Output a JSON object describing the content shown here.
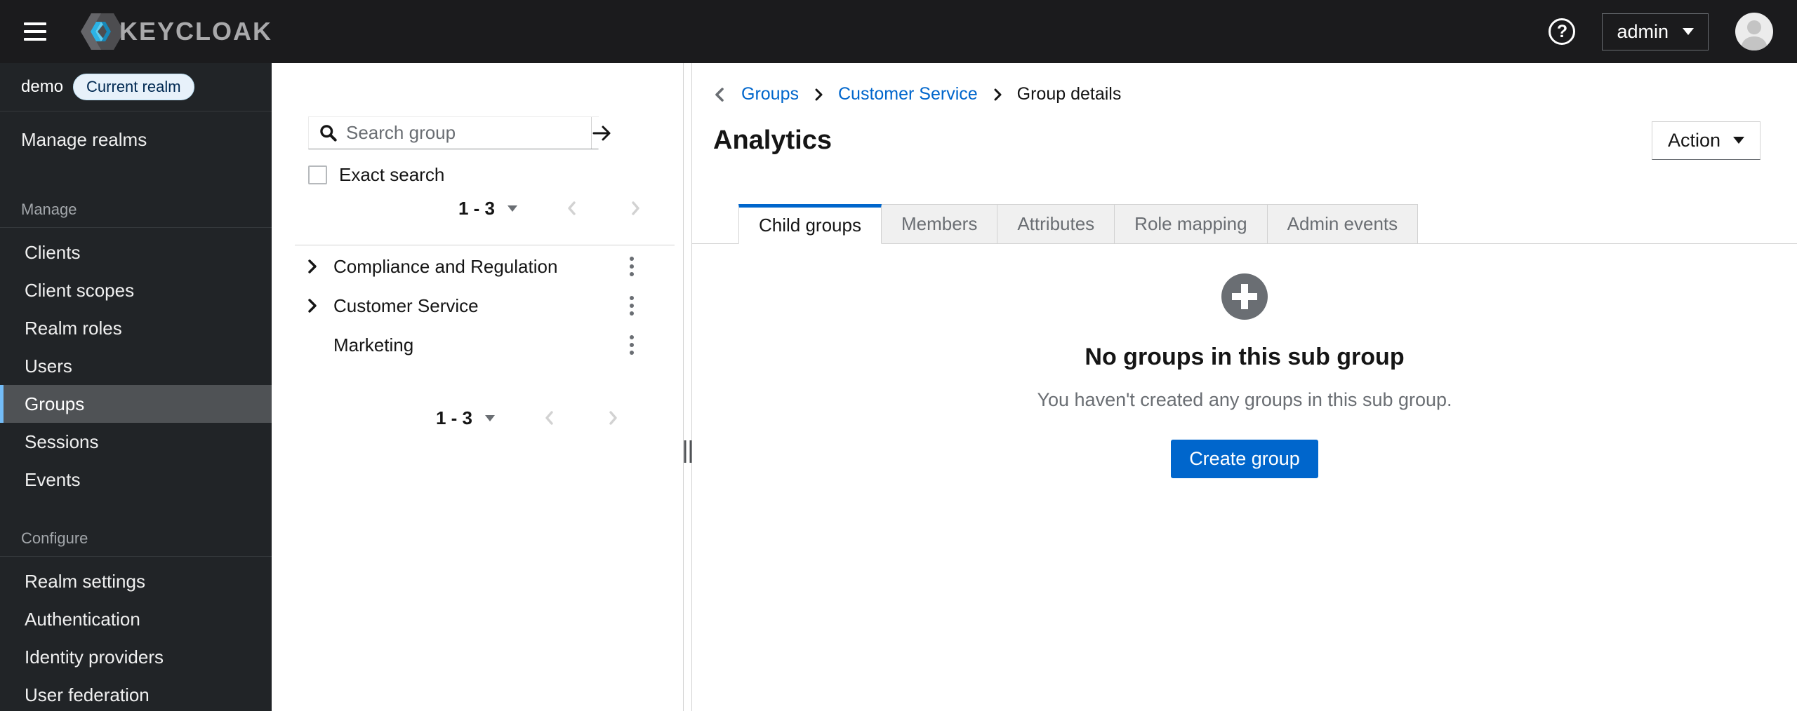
{
  "masthead": {
    "brand": "KEYCLOAK",
    "user": {
      "name": "admin"
    },
    "icons": {
      "menu": "hamburger-icon",
      "help": "question-circle-icon",
      "avatar": "user-avatar"
    }
  },
  "sidebar": {
    "realm": {
      "name": "demo",
      "badge": "Current realm"
    },
    "manage_realms_label": "Manage realms",
    "sections": [
      {
        "label": "Manage",
        "items": [
          {
            "label": "Clients",
            "active": false
          },
          {
            "label": "Client scopes",
            "active": false
          },
          {
            "label": "Realm roles",
            "active": false
          },
          {
            "label": "Users",
            "active": false
          },
          {
            "label": "Groups",
            "active": true
          },
          {
            "label": "Sessions",
            "active": false
          },
          {
            "label": "Events",
            "active": false
          }
        ]
      },
      {
        "label": "Configure",
        "items": [
          {
            "label": "Realm settings",
            "active": false
          },
          {
            "label": "Authentication",
            "active": false
          },
          {
            "label": "Identity providers",
            "active": false
          },
          {
            "label": "User federation",
            "active": false
          }
        ]
      }
    ]
  },
  "group_panel": {
    "search": {
      "placeholder": "Search group",
      "value": ""
    },
    "exact_search_label": "Exact search",
    "pagination": {
      "range": "1 - 3"
    },
    "groups": [
      {
        "name": "Compliance and Regulation",
        "expandable": true
      },
      {
        "name": "Customer Service",
        "expandable": true
      },
      {
        "name": "Marketing",
        "expandable": false
      }
    ]
  },
  "content": {
    "breadcrumb": [
      {
        "label": "Groups",
        "link": true
      },
      {
        "label": "Customer Service",
        "link": true
      },
      {
        "label": "Group details",
        "link": false
      }
    ],
    "title": "Analytics",
    "action_label": "Action",
    "tabs": [
      {
        "label": "Child groups",
        "active": true
      },
      {
        "label": "Members",
        "active": false
      },
      {
        "label": "Attributes",
        "active": false
      },
      {
        "label": "Role mapping",
        "active": false
      },
      {
        "label": "Admin events",
        "active": false
      }
    ],
    "empty_state": {
      "title": "No groups in this sub group",
      "description": "You haven't created any groups in this sub group.",
      "button_label": "Create group"
    }
  },
  "colors": {
    "accent_blue": "#0066CC",
    "nav_active_indicator": "#73BCF7",
    "nav_active_bg": "#4F5255",
    "masthead_bg": "#1B1B1D",
    "sidebar_bg": "#212427",
    "badge_bg": "#E7F1FA",
    "badge_text": "#002952",
    "muted_gray": "#6A6E73",
    "border_gray": "#D2D2D2"
  }
}
